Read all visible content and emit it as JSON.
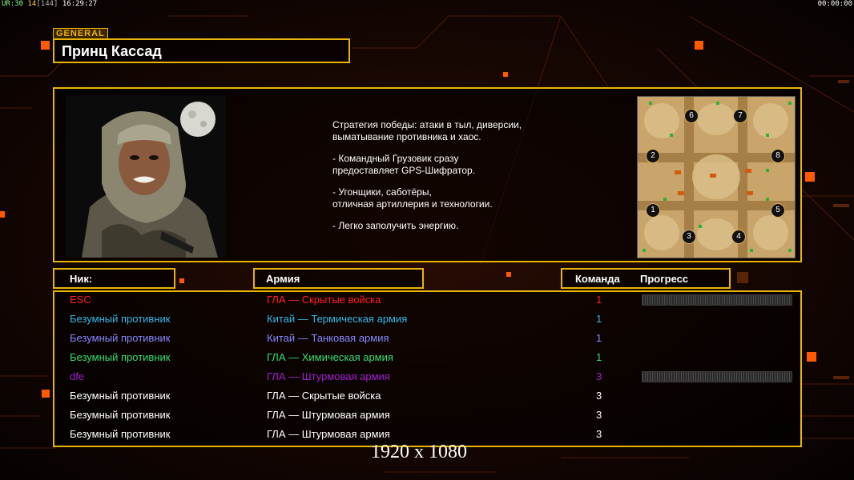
{
  "hud": {
    "left": [
      {
        "text": "UR:30",
        "color": "#8cff8c"
      },
      {
        "text": "14",
        "color": "#ffd23a"
      },
      {
        "text": "[144]",
        "color": "#b0b0b0"
      },
      {
        "text": "16:29:27",
        "color": "#ffffff"
      }
    ],
    "right": "00:00:00"
  },
  "general_tag": "GENERAL",
  "general_name": "Принц Кассад",
  "description": [
    "Стратегия победы: атаки в тыл, диверсии,\n выматывание противника и хаос.",
    "- Командный Грузовик сразу\nпредоставляет GPS-Шифратор.",
    "- Угонщики, саботёры,\nотличная артиллерия и технологии.",
    "- Легко заполучить энергию."
  ],
  "map_slots": [
    "1",
    "2",
    "3",
    "4",
    "5",
    "6",
    "7",
    "8"
  ],
  "columns": {
    "nick": "Ник:",
    "army": "Армия",
    "team": "Команда",
    "progress": "Прогресс"
  },
  "players": [
    {
      "nick": "ESC",
      "army": "ГЛА — Скрытые войска",
      "team": "1",
      "color": "#ff2020",
      "progress": true
    },
    {
      "nick": "Безумный противник",
      "army": "Китай — Термическая армия",
      "team": "1",
      "color": "#33b8e8",
      "progress": false
    },
    {
      "nick": "Безумный противник",
      "army": "Китай — Танковая армия",
      "team": "1",
      "color": "#8888ff",
      "progress": false
    },
    {
      "nick": "Безумный противник",
      "army": "ГЛА — Химическая армия",
      "team": "1",
      "color": "#33e070",
      "progress": false
    },
    {
      "nick": "dfe",
      "army": "ГЛА — Штурмовая армия",
      "team": "3",
      "color": "#a020d0",
      "progress": true
    },
    {
      "nick": "Безумный противник",
      "army": "ГЛА — Скрытые войска",
      "team": "3",
      "color": "#ffffff",
      "progress": false
    },
    {
      "nick": "Безумный противник",
      "army": "ГЛА — Штурмовая армия",
      "team": "3",
      "color": "#ffffff",
      "progress": false
    },
    {
      "nick": "Безумный противник",
      "army": "ГЛА — Штурмовая армия",
      "team": "3",
      "color": "#ffffff",
      "progress": false
    }
  ],
  "resolution_label": "1920 x 1080",
  "colors": {
    "frame": "#e8b500",
    "accent": "#ff6a00",
    "background": "#0a0402"
  }
}
